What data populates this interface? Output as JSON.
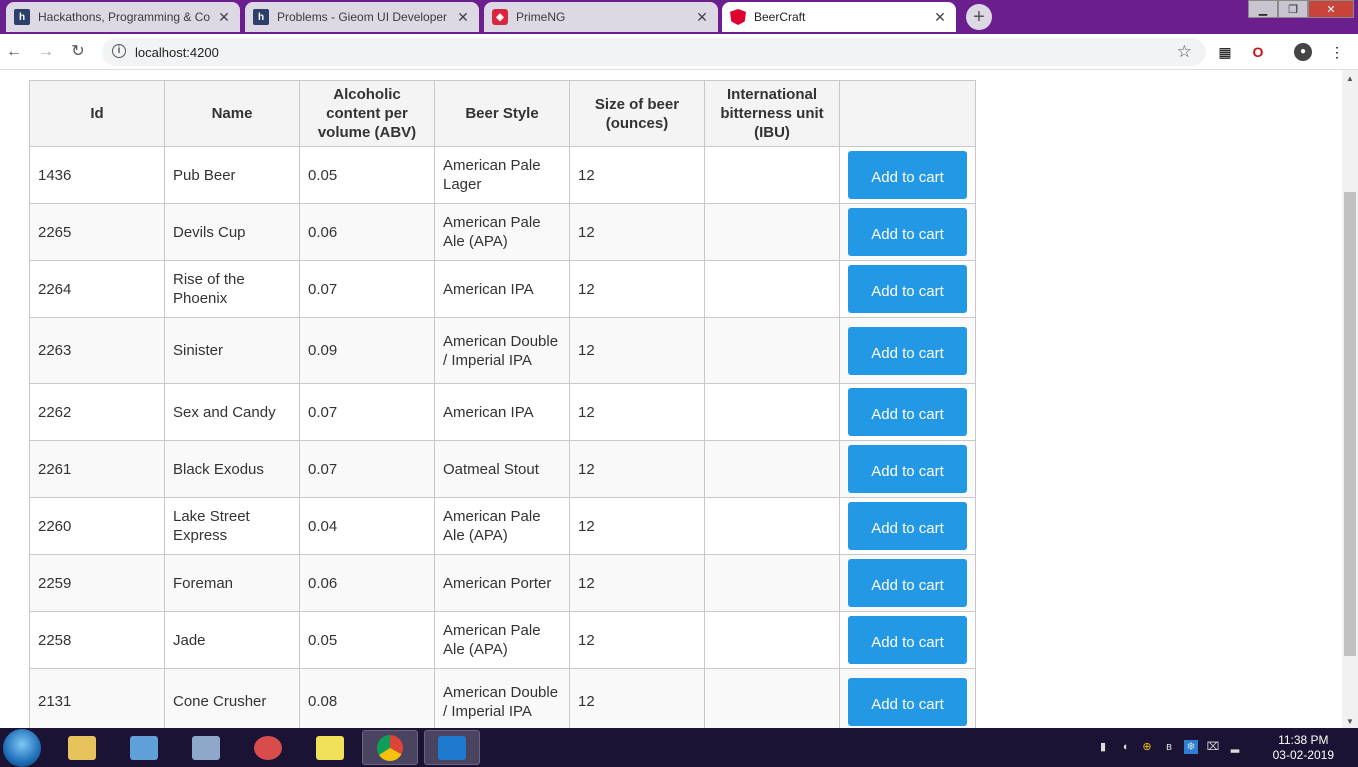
{
  "browser": {
    "tabs": [
      {
        "title": "Hackathons, Programming & Co",
        "favicon": "h"
      },
      {
        "title": "Problems - Gieom UI Developer",
        "favicon": "h"
      },
      {
        "title": "PrimeNG",
        "favicon": "primeng-icon"
      },
      {
        "title": "BeerCraft",
        "favicon": "angular-icon",
        "active": true
      }
    ],
    "url": "localhost:4200"
  },
  "table": {
    "headers": [
      "Id",
      "Name",
      "Alcoholic content per volume (ABV)",
      "Beer Style",
      "Size of beer (ounces)",
      "International bitterness unit (IBU)",
      ""
    ],
    "button_label": "Add to cart",
    "rows": [
      {
        "id": "1436",
        "name": "Pub Beer",
        "abv": "0.05",
        "style": "American Pale Lager",
        "ounces": "12",
        "ibu": ""
      },
      {
        "id": "2265",
        "name": "Devils Cup",
        "abv": "0.06",
        "style": "American Pale Ale (APA)",
        "ounces": "12",
        "ibu": ""
      },
      {
        "id": "2264",
        "name": "Rise of the Phoenix",
        "abv": "0.07",
        "style": "American IPA",
        "ounces": "12",
        "ibu": ""
      },
      {
        "id": "2263",
        "name": "Sinister",
        "abv": "0.09",
        "style": "American Double / Imperial IPA",
        "ounces": "12",
        "ibu": ""
      },
      {
        "id": "2262",
        "name": "Sex and Candy",
        "abv": "0.07",
        "style": "American IPA",
        "ounces": "12",
        "ibu": ""
      },
      {
        "id": "2261",
        "name": "Black Exodus",
        "abv": "0.07",
        "style": "Oatmeal Stout",
        "ounces": "12",
        "ibu": ""
      },
      {
        "id": "2260",
        "name": "Lake Street Express",
        "abv": "0.04",
        "style": "American Pale Ale (APA)",
        "ounces": "12",
        "ibu": ""
      },
      {
        "id": "2259",
        "name": "Foreman",
        "abv": "0.06",
        "style": "American Porter",
        "ounces": "12",
        "ibu": ""
      },
      {
        "id": "2258",
        "name": "Jade",
        "abv": "0.05",
        "style": "American Pale Ale (APA)",
        "ounces": "12",
        "ibu": ""
      },
      {
        "id": "2131",
        "name": "Cone Crusher",
        "abv": "0.08",
        "style": "American Double / Imperial IPA",
        "ounces": "12",
        "ibu": ""
      }
    ]
  },
  "taskbar": {
    "time": "11:38 PM",
    "date": "03-02-2019"
  },
  "colors": {
    "accent": "#2399e5",
    "titlebar": "#6b1f8f",
    "taskbar": "#1b1333"
  }
}
